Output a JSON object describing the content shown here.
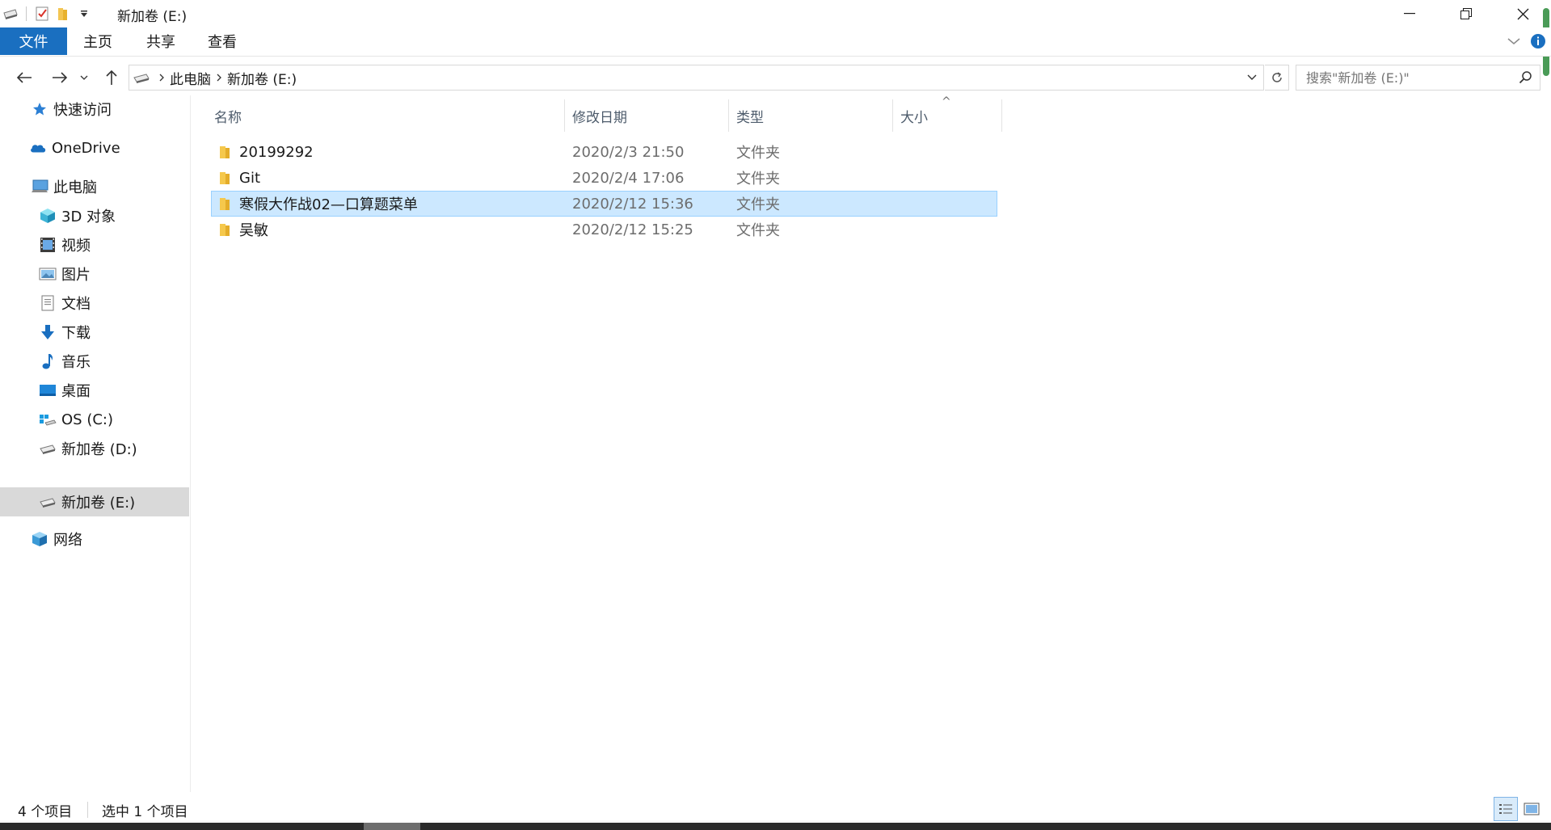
{
  "window": {
    "title": "新加卷 (E:)",
    "controls": {
      "minimize": "─",
      "restore": "❐",
      "close": "✕"
    }
  },
  "quick_access_toolbar": {
    "icons": [
      "drive-icon",
      "properties-icon",
      "new-folder-icon",
      "customize-dropdown-icon"
    ]
  },
  "ribbon": {
    "tabs": [
      "文件",
      "主页",
      "共享",
      "查看"
    ],
    "accent_color": "#1a6fc0"
  },
  "address": {
    "crumbs": [
      "此电脑",
      "新加卷 (E:)"
    ]
  },
  "search": {
    "placeholder": "搜索\"新加卷 (E:)\""
  },
  "nav_pane": {
    "items": [
      {
        "label": "快速访问",
        "icon": "star-icon"
      },
      {
        "label": "OneDrive",
        "icon": "cloud-icon"
      },
      {
        "label": "此电脑",
        "icon": "computer-icon"
      },
      {
        "label": "3D 对象",
        "icon": "3d-objects-icon"
      },
      {
        "label": "视频",
        "icon": "video-icon"
      },
      {
        "label": "图片",
        "icon": "pictures-icon"
      },
      {
        "label": "文档",
        "icon": "documents-icon"
      },
      {
        "label": "下载",
        "icon": "download-icon"
      },
      {
        "label": "音乐",
        "icon": "music-icon"
      },
      {
        "label": "桌面",
        "icon": "desktop-icon"
      },
      {
        "label": "OS (C:)",
        "icon": "os-drive-icon"
      },
      {
        "label": "新加卷 (D:)",
        "icon": "drive-icon"
      },
      {
        "label": "新加卷 (E:)",
        "icon": "drive-icon",
        "selected": true
      },
      {
        "label": "网络",
        "icon": "network-icon"
      }
    ]
  },
  "file_list": {
    "columns": [
      "名称",
      "修改日期",
      "类型",
      "大小"
    ],
    "sort_indicator": "^",
    "rows": [
      {
        "name": "20199292",
        "modified": "2020/2/3 21:50",
        "type": "文件夹",
        "size": ""
      },
      {
        "name": "Git",
        "modified": "2020/2/4 17:06",
        "type": "文件夹",
        "size": ""
      },
      {
        "name": "寒假大作战02—口算题菜单",
        "modified": "2020/2/12 15:36",
        "type": "文件夹",
        "size": "",
        "selected": true
      },
      {
        "name": "吴敏",
        "modified": "2020/2/12 15:25",
        "type": "文件夹",
        "size": ""
      }
    ]
  },
  "status": {
    "item_count": "4 个项目",
    "selection": "选中 1 个项目"
  }
}
